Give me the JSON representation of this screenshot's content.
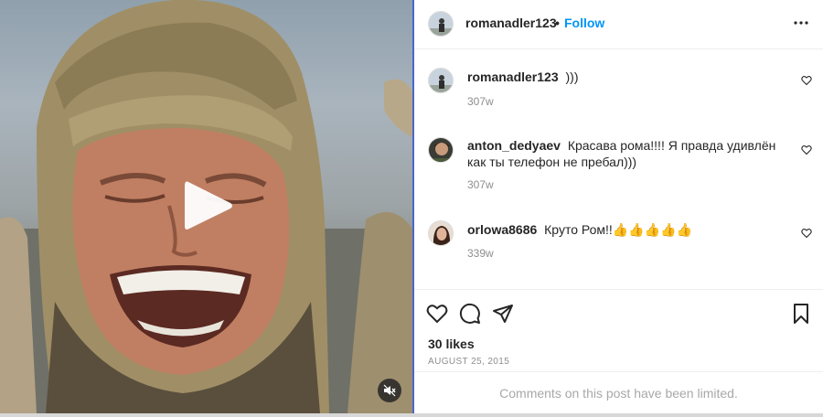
{
  "post": {
    "author": "romanadler123",
    "follow_label": "Follow",
    "dot": "•"
  },
  "comments": [
    {
      "username": "romanadler123",
      "text": ")))",
      "age": "307w"
    },
    {
      "username": "anton_dedyaev",
      "text": "Красава рома!!!! Я правда удивлён как ты телефон не пребал)))",
      "age": "307w"
    },
    {
      "username": "orlowa8686",
      "text": "Круто Ром!!👍👍👍👍👍",
      "age": "339w"
    }
  ],
  "footer": {
    "likes": "30 likes",
    "date": "AUGUST 25, 2015",
    "limited_text": "Comments on this post have been limited."
  },
  "icons": {
    "play": "play-icon",
    "mute": "muted-speaker-icon",
    "more": "more-options-icon",
    "like": "heart-icon",
    "comment": "comment-bubble-icon",
    "share": "paper-plane-icon",
    "save": "bookmark-icon"
  },
  "colors": {
    "accent": "#0095f6",
    "text": "#262626",
    "muted": "#8e8e8e"
  }
}
